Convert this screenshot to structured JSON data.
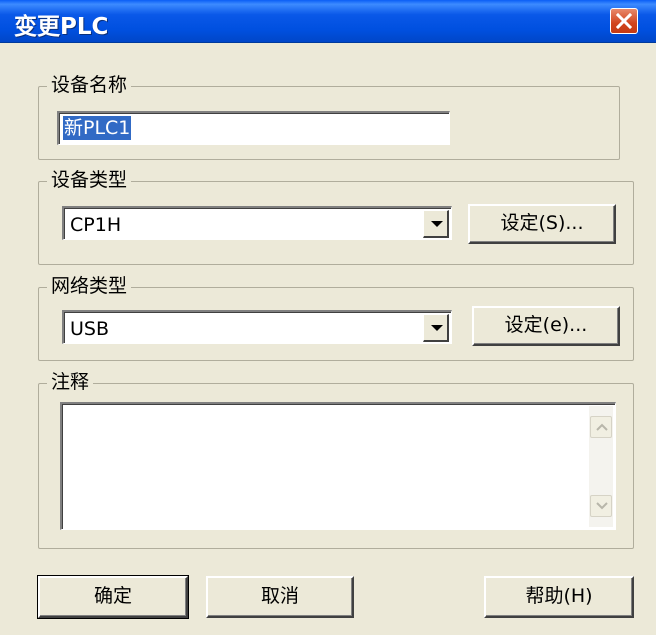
{
  "window": {
    "title": "变更PLC"
  },
  "device_name": {
    "group_label": "设备名称",
    "value": "新PLC1"
  },
  "device_type": {
    "group_label": "设备类型",
    "value": "CP1H",
    "settings_label": "设定(S)..."
  },
  "network_type": {
    "group_label": "网络类型",
    "value": "USB",
    "settings_label": "设定(e)..."
  },
  "comment": {
    "group_label": "注释",
    "value": ""
  },
  "buttons": {
    "ok": "确定",
    "cancel": "取消",
    "help": "帮助(H)"
  },
  "colors": {
    "titlebar": "#0054e3",
    "close": "#d1441d",
    "dialog_bg": "#ece9d8",
    "selection": "#316ac5"
  }
}
